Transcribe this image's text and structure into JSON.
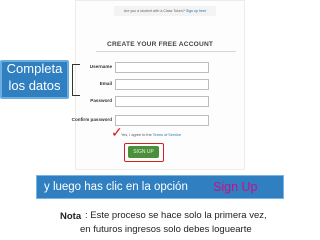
{
  "form": {
    "teacher_prompt": "Are you a student with a Class Token?",
    "teacher_link": "Sign up here",
    "title": "CREATE YOUR FREE ACCOUNT",
    "fields": [
      {
        "label": "Username"
      },
      {
        "label": "Email"
      },
      {
        "label": "Password"
      },
      {
        "label": "Confirm password"
      }
    ],
    "terms_prefix": "Yes, I agree to the",
    "terms_link": "Terms of Service",
    "signup_button": "SIGN UP"
  },
  "callout": {
    "line1": "Completa",
    "line2": "los datos"
  },
  "banner": {
    "text": "y luego has clic en la opción",
    "emphasis": "Sign Up"
  },
  "note": {
    "label": "Nota",
    "line1": ": Este proceso se hace solo la primera vez,",
    "line2": "en futuros ingresos solo debes loguearte"
  },
  "colors": {
    "callout_blue": "#2f7fc1",
    "emphasis_magenta": "#c80f86",
    "signup_green": "#4a8f3a",
    "highlight_red": "#d42020"
  }
}
